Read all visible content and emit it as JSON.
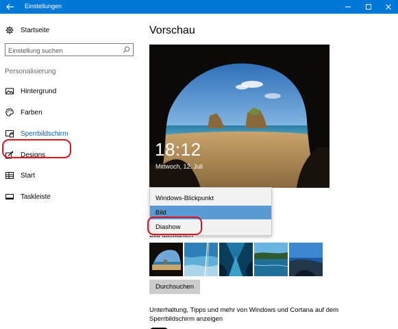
{
  "window": {
    "title": "Einstellungen"
  },
  "sidebar": {
    "home_label": "Startseite",
    "search_placeholder": "Einstellung suchen",
    "section_title": "Personalisierung",
    "items": [
      {
        "label": "Hintergrund",
        "icon": "picture-icon"
      },
      {
        "label": "Farben",
        "icon": "palette-icon"
      },
      {
        "label": "Sperrbildschirm",
        "icon": "lock-screen-icon",
        "selected": true
      },
      {
        "label": "Designs",
        "icon": "brush-icon"
      },
      {
        "label": "Start",
        "icon": "start-tiles-icon"
      },
      {
        "label": "Taskleiste",
        "icon": "taskbar-icon"
      }
    ]
  },
  "main": {
    "title": "Vorschau",
    "preview": {
      "time": "18:12",
      "date": "Mittwoch, 12. Juli"
    },
    "background_dropdown": {
      "options": [
        "Windows-Blickpunkt",
        "Bild",
        "Diashow"
      ],
      "selected": "Bild"
    },
    "choose_picture_label": "Bild auswählen",
    "browse_button": "Durchsuchen",
    "tips_text": "Unterhaltung, Tipps und mehr von Windows und Cortana auf dem Sperrbildschirm anzeigen"
  },
  "colors": {
    "accent": "#0078d7",
    "highlight": "#5b9bd5",
    "annotation": "#e0101a"
  }
}
